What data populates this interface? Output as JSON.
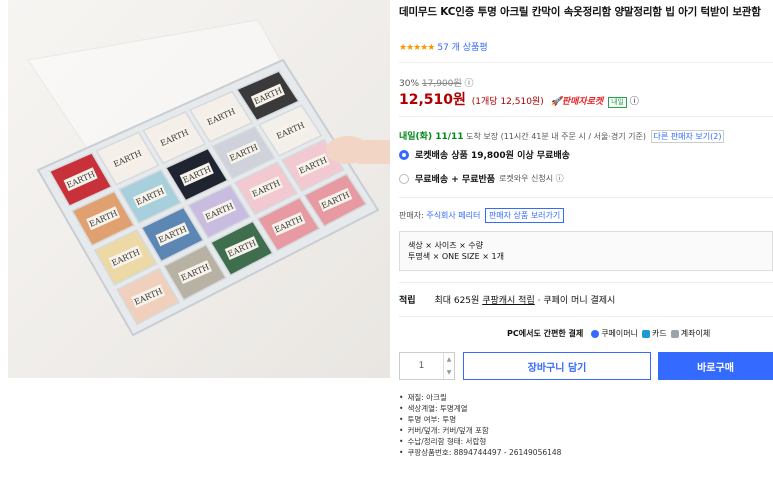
{
  "product": {
    "title": "데미무드 KC인증 투명 아크릴 칸막이 속옷정리함 양말정리함 빕 아기 턱받이 보관함",
    "rating_stars": "★★★★★",
    "review_count": "57 개 상품평",
    "image_label": "EARTH"
  },
  "pricing": {
    "discount_pct": "30%",
    "original_price": "17,900원",
    "info_icon": "ⓘ",
    "sale_price": "12,510원",
    "unit_price": "(1개당 12,510원)",
    "rocket_label": "🚀판매자로켓",
    "rocket_badge": "내일"
  },
  "delivery": {
    "date": "내일(화) 11/11",
    "date_suffix": "도착 보장",
    "detail": "(11시간 41분 내 주문 시 / 서울⋅경기 기준)",
    "seller_button": "다른 판매자 보기(2)"
  },
  "shipping_options": [
    {
      "label": "로켓배송 상품 19,800원 이상 무료배송",
      "sub": "",
      "selected": true
    },
    {
      "label": "무료배송 + 무료반품",
      "sub": "로켓와우 신청시 ⓘ",
      "selected": false
    }
  ],
  "seller": {
    "prefix": "판매자:",
    "name": "주식회사 페리터",
    "button": "판매자 상품 보러가기"
  },
  "option_box": {
    "label": "색상 × 사이즈 × 수량",
    "value": "투명색 × ONE SIZE × 1개"
  },
  "cash": {
    "label": "적립",
    "text": "최대 625원",
    "link": "쿠팡캐시 적립",
    "suffix": "· 쿠페이 머니 결제시"
  },
  "pc_pay": {
    "label": "PC에서도 간편한 결제",
    "methods": [
      "쿠페이머니",
      "카드",
      "계좌이체"
    ],
    "colors": [
      "#346aff",
      "#1c9ad6",
      "#9aa4b1"
    ]
  },
  "purchase": {
    "quantity": "1",
    "cart_label": "장바구니 담기",
    "buy_label": "바로구매"
  },
  "attributes": [
    "재질: 아크릴",
    "색상계열: 투명계열",
    "투명 여부: 투명",
    "커버/덮개: 커버/덮개 포함",
    "수납/정리함 형태: 서랍형",
    "쿠팡상품번호: 8894744497 - 26149056148"
  ]
}
